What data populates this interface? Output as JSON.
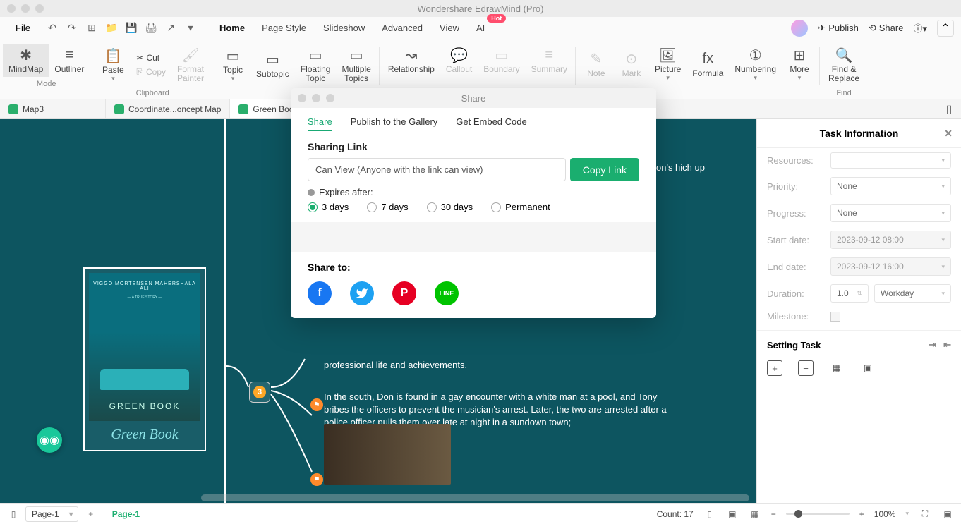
{
  "app_title": "Wondershare EdrawMind (Pro)",
  "menu": {
    "file": "File",
    "tabs": [
      "Home",
      "Page Style",
      "Slideshow",
      "Advanced",
      "View",
      "AI"
    ],
    "active_tab": "Home",
    "hot_badge": "Hot",
    "publish": "Publish",
    "share": "Share"
  },
  "ribbon": {
    "mindmap": "MindMap",
    "outliner": "Outliner",
    "mode": "Mode",
    "paste": "Paste",
    "cut": "Cut",
    "copy": "Copy",
    "format_painter": "Format\nPainter",
    "clipboard": "Clipboard",
    "topic": "Topic",
    "subtopic": "Subtopic",
    "floating_topic": "Floating\nTopic",
    "multiple_topics": "Multiple\nTopics",
    "relationship": "Relationship",
    "callout": "Callout",
    "boundary": "Boundary",
    "summary": "Summary",
    "note": "Note",
    "mark": "Mark",
    "picture": "Picture",
    "formula": "Formula",
    "numbering": "Numbering",
    "more": "More",
    "find_replace": "Find &\nReplace",
    "find": "Find"
  },
  "doctabs": {
    "tab1": "Map3",
    "tab2": "Coordinate...oncept Map",
    "tab3": "Green Book"
  },
  "canvas": {
    "green_book_title": "Green Book",
    "poster_actors": "VIGGO MORTENSEN     MAHERSHALA ALI",
    "poster_title": "GREEN BOOK",
    "node_badge": "3",
    "text_right": "on's hich up",
    "text_mid": "professional life and achievements.",
    "text_body": "In the south, Don is found in a gay encounter with a white man at a pool, and Tony bribes the officers to prevent the musician's arrest. Later, the two are arrested after a police officer pulls them over late at night in a sundown town;"
  },
  "dialog": {
    "title": "Share",
    "tabs": {
      "share": "Share",
      "gallery": "Publish to the Gallery",
      "embed": "Get Embed Code"
    },
    "sharing_link": "Sharing Link",
    "link_value": "Can View (Anyone with the link can view)",
    "copy_link": "Copy Link",
    "expires_after": "Expires after:",
    "opt_3days": "3 days",
    "opt_7days": "7 days",
    "opt_30days": "30 days",
    "opt_perm": "Permanent",
    "share_to": "Share to:"
  },
  "task_panel": {
    "title": "Task Information",
    "resources": "Resources:",
    "priority": "Priority:",
    "progress": "Progress:",
    "start_date": "Start date:",
    "end_date": "End date:",
    "duration": "Duration:",
    "milestone": "Milestone:",
    "none": "None",
    "start_val": "2023-09-12  08:00",
    "end_val": "2023-09-12  16:00",
    "dur_val": "1.0",
    "dur_unit": "Workday",
    "setting_task": "Setting Task"
  },
  "status": {
    "page_sel": "Page-1",
    "page_active": "Page-1",
    "count": "Count: 17",
    "zoom": "100%"
  }
}
